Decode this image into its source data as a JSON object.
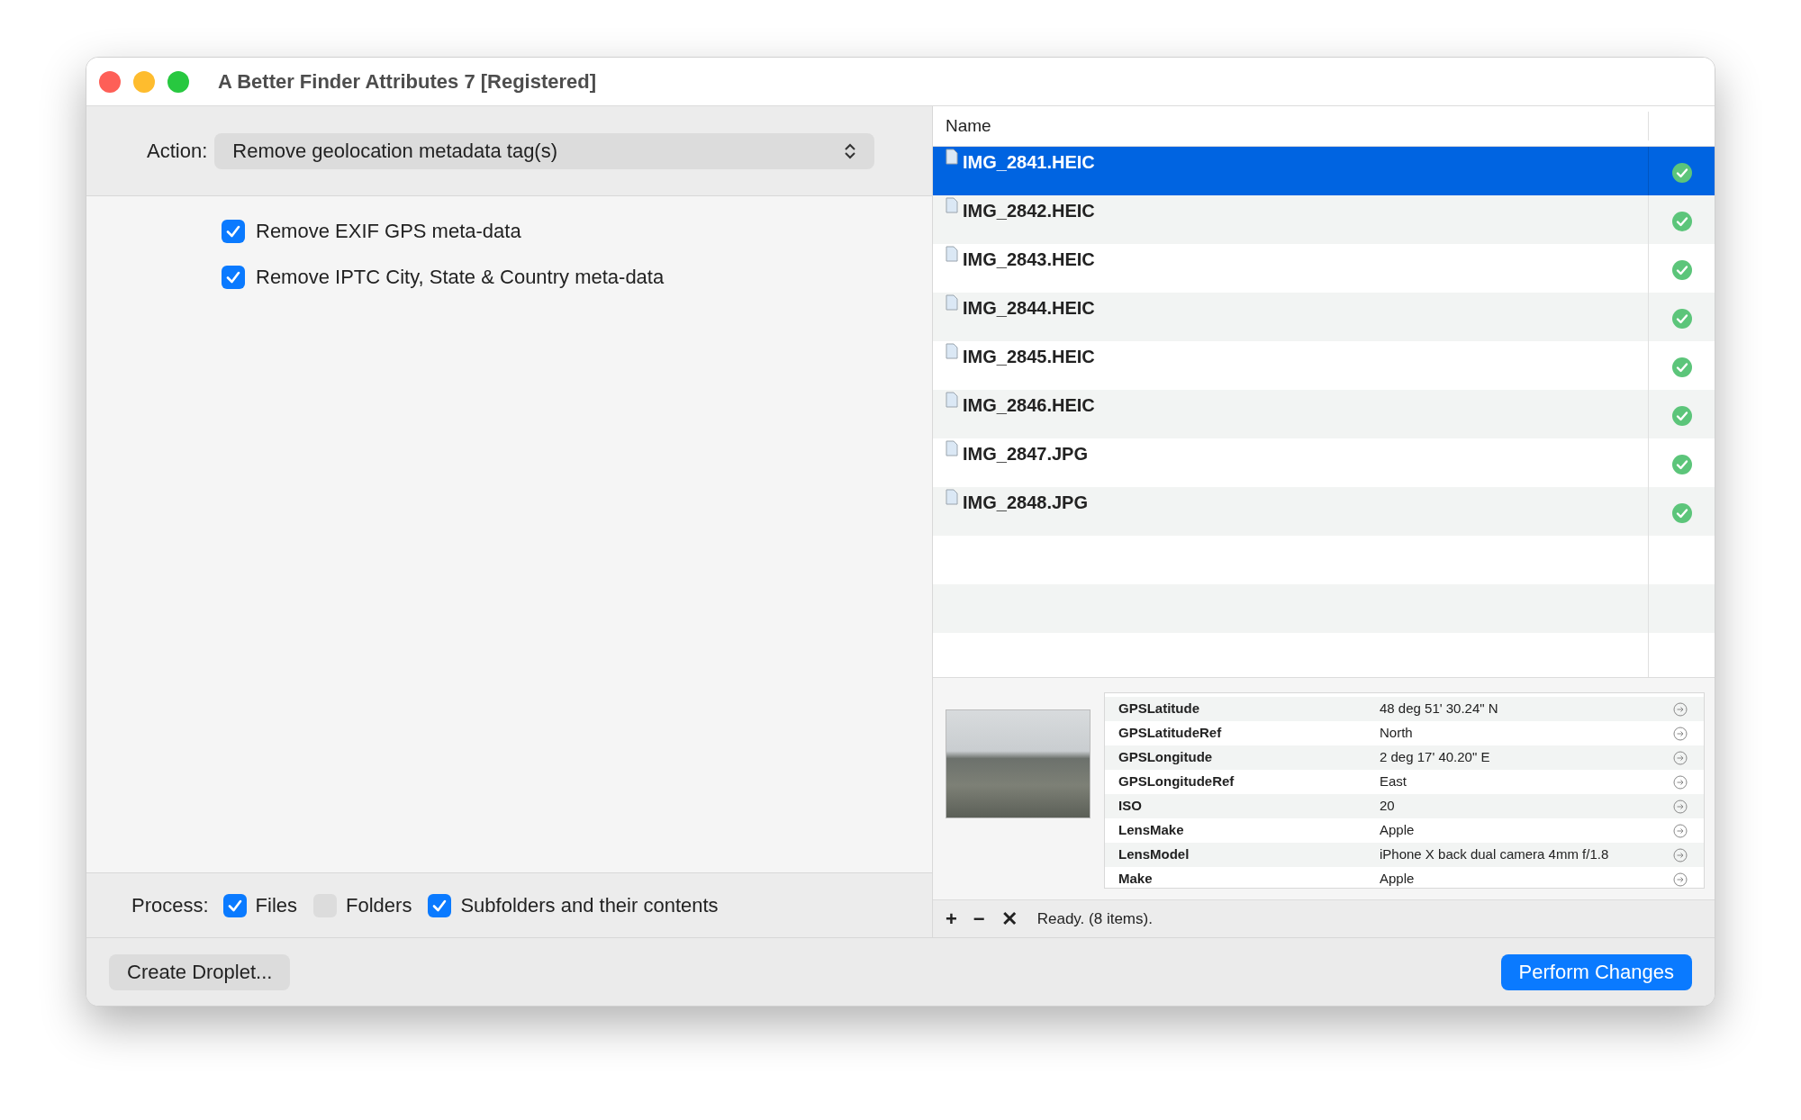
{
  "window": {
    "title": "A Better Finder Attributes 7 [Registered]"
  },
  "action": {
    "label": "Action:",
    "value": "Remove geolocation metadata tag(s)"
  },
  "options": [
    {
      "label": "Remove EXIF GPS meta-data",
      "checked": true
    },
    {
      "label": "Remove IPTC City, State & Country meta-data",
      "checked": true
    }
  ],
  "process": {
    "label": "Process:",
    "options": [
      {
        "label": "Files",
        "checked": true
      },
      {
        "label": "Folders",
        "checked": false
      },
      {
        "label": "Subfolders and their contents",
        "checked": true
      }
    ]
  },
  "files": {
    "column": "Name",
    "rows": [
      {
        "name": "IMG_2841.HEIC",
        "selected": true,
        "done": true
      },
      {
        "name": "IMG_2842.HEIC",
        "selected": false,
        "done": true
      },
      {
        "name": "IMG_2843.HEIC",
        "selected": false,
        "done": true
      },
      {
        "name": "IMG_2844.HEIC",
        "selected": false,
        "done": true
      },
      {
        "name": "IMG_2845.HEIC",
        "selected": false,
        "done": true
      },
      {
        "name": "IMG_2846.HEIC",
        "selected": false,
        "done": true
      },
      {
        "name": "IMG_2847.JPG",
        "selected": false,
        "done": true
      },
      {
        "name": "IMG_2848.JPG",
        "selected": false,
        "done": true
      }
    ]
  },
  "metadata": [
    {
      "tag": "GPSLatitude",
      "value": "48 deg 51' 30.24\" N"
    },
    {
      "tag": "GPSLatitudeRef",
      "value": "North"
    },
    {
      "tag": "GPSLongitude",
      "value": "2 deg 17' 40.20\" E"
    },
    {
      "tag": "GPSLongitudeRef",
      "value": "East"
    },
    {
      "tag": "ISO",
      "value": "20"
    },
    {
      "tag": "LensMake",
      "value": "Apple"
    },
    {
      "tag": "LensModel",
      "value": "iPhone X back dual camera 4mm f/1.8"
    },
    {
      "tag": "Make",
      "value": "Apple"
    }
  ],
  "status_bar": {
    "buttons": [
      "+",
      "−",
      "✕"
    ],
    "text": "Ready. (8 items)."
  },
  "footer": {
    "droplet": "Create Droplet...",
    "perform": "Perform Changes"
  }
}
